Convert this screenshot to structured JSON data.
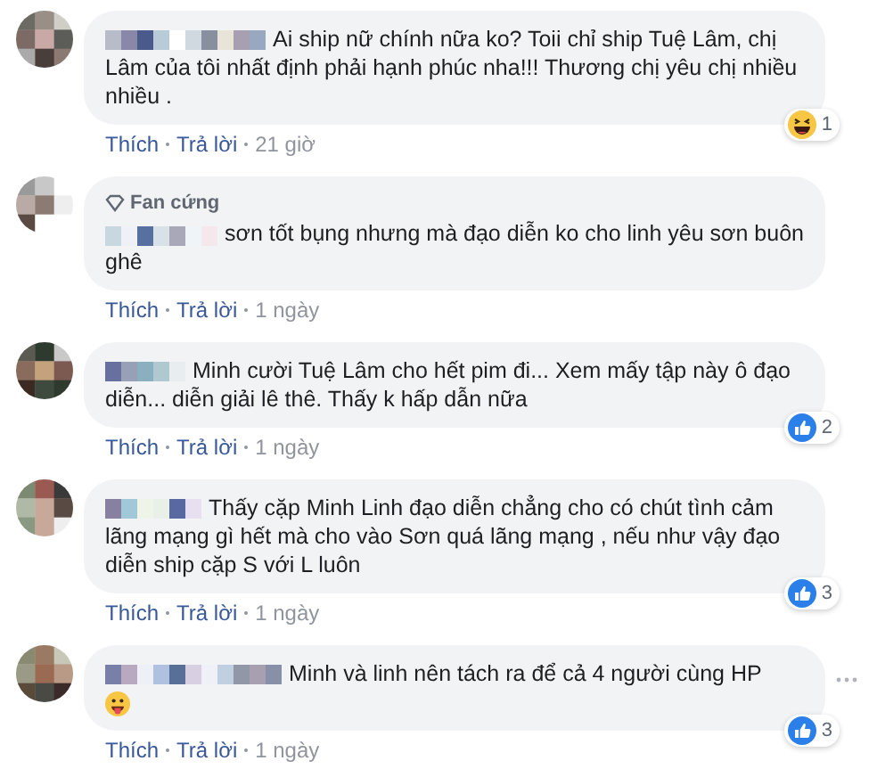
{
  "comments": [
    {
      "text": "Ai ship nữ chính nữa ko? Toii chỉ ship Tuệ Lâm, chị Lâm của tôi nhất định phải hạnh phúc nha!!! Thương chị yêu chị nhiều nhiều .",
      "emoji_end": false,
      "reaction": {
        "kind": "haha",
        "count": "1"
      },
      "actions": [
        "Thích",
        "Trả lời"
      ],
      "time": "21 giờ",
      "menu": false
    },
    {
      "badge": "Fan cứng",
      "text": "sơn tốt bụng nhưng mà đạo diễn ko cho linh yêu sơn buôn ghê",
      "emoji_end": false,
      "actions": [
        "Thích",
        "Trả lời"
      ],
      "time": "1 ngày",
      "menu": false
    },
    {
      "text": "Minh cười Tuệ Lâm cho hết pim đi... Xem mấy tập này ô đạo diễn... diễn giải lê thê. Thấy k hấp dẫn nữa",
      "emoji_end": false,
      "reaction": {
        "kind": "like",
        "count": "2"
      },
      "actions": [
        "Thích",
        "Trả lời"
      ],
      "time": "1 ngày",
      "menu": false
    },
    {
      "text": "Thấy cặp Minh Linh đạo diễn chẳng cho có chút tình cảm lãng mạng gì hết mà cho vào Sơn quá lãng mạng , nếu như vậy đạo diễn ship cặp S với L luôn",
      "emoji_end": false,
      "reaction": {
        "kind": "like",
        "count": "3"
      },
      "actions": [
        "Thích",
        "Trả lời"
      ],
      "time": "1 ngày",
      "menu": false
    },
    {
      "text": "Minh và linh nên tách ra để cả 4 người cùng HP",
      "emoji_end": true,
      "reaction": {
        "kind": "like",
        "count": "3"
      },
      "actions": [
        "Thích",
        "Trả lời"
      ],
      "time": "1 ngày",
      "menu": true
    }
  ]
}
